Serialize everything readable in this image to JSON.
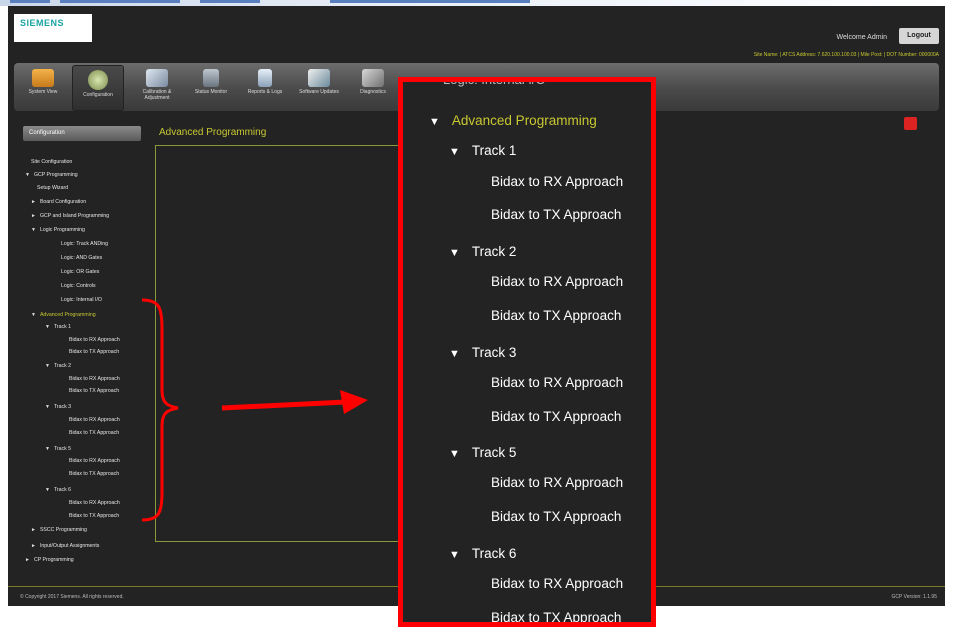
{
  "header": {
    "logo": "SIEMENS",
    "welcome": "Welcome Admin",
    "logout": "Logout",
    "site_info": "Site Name: | ATCS Address: 7.620.100.100.03 | Mile Post: | DOT Number: 000000A"
  },
  "toolbar": {
    "items": [
      {
        "label": "System View",
        "icon": "house-icon"
      },
      {
        "label": "Configuration",
        "icon": "gears-icon"
      },
      {
        "label": "Calibration & Adjustment",
        "icon": "wrench-icon"
      },
      {
        "label": "Status Monitor",
        "icon": "monitor-icon"
      },
      {
        "label": "Reports & Logs",
        "icon": "document-icon"
      },
      {
        "label": "Software Updates",
        "icon": "update-icon"
      },
      {
        "label": "Diagnostics",
        "icon": "diagnostics-icon"
      }
    ]
  },
  "sidebar": {
    "header": "Configuration",
    "items": [
      {
        "label": "Site Configuration"
      },
      {
        "label": "GCP Programming"
      },
      {
        "label": "Setup Wizard"
      },
      {
        "label": "Board Configuration"
      },
      {
        "label": "GCP and Island Programming"
      },
      {
        "label": "Logic Programming"
      },
      {
        "label": "Logic: Track ANDing"
      },
      {
        "label": "Logic: AND Gates"
      },
      {
        "label": "Logic: OR Gates"
      },
      {
        "label": "Logic: Controls"
      },
      {
        "label": "Logic: Internal I/O"
      },
      {
        "label": "Advanced Programming"
      },
      {
        "label": "Track 1"
      },
      {
        "label": "Bidax to RX Approach"
      },
      {
        "label": "Bidax to TX Approach"
      },
      {
        "label": "Track 2"
      },
      {
        "label": "Bidax to RX Approach"
      },
      {
        "label": "Bidax to TX Approach"
      },
      {
        "label": "Track 3"
      },
      {
        "label": "Bidax to RX Approach"
      },
      {
        "label": "Bidax to TX Approach"
      },
      {
        "label": "Track 5"
      },
      {
        "label": "Bidax to RX Approach"
      },
      {
        "label": "Bidax to TX Approach"
      },
      {
        "label": "Track 6"
      },
      {
        "label": "Bidax to RX Approach"
      },
      {
        "label": "Bidax to TX Approach"
      },
      {
        "label": "SSCC Programming"
      },
      {
        "label": "Input/Output Assignments"
      },
      {
        "label": "CP Programming"
      }
    ]
  },
  "main": {
    "title": "Advanced Programming"
  },
  "zoom": {
    "cut_label": "Logic: Internal I/O",
    "items": [
      {
        "label": "Advanced Programming"
      },
      {
        "label": "Track 1"
      },
      {
        "label": "Bidax to RX Approach"
      },
      {
        "label": "Bidax to TX Approach"
      },
      {
        "label": "Track 2"
      },
      {
        "label": "Bidax to RX Approach"
      },
      {
        "label": "Bidax to TX Approach"
      },
      {
        "label": "Track 3"
      },
      {
        "label": "Bidax to RX Approach"
      },
      {
        "label": "Bidax to TX Approach"
      },
      {
        "label": "Track 5"
      },
      {
        "label": "Bidax to RX Approach"
      },
      {
        "label": "Bidax to TX Approach"
      },
      {
        "label": "Track 6"
      },
      {
        "label": "Bidax to RX Approach"
      },
      {
        "label": "Bidax to TX Approach"
      }
    ]
  },
  "footer": {
    "copyright": "© Copyright 2017 Siemens. All rights reserved.",
    "version": "GCP Version: 1.1.95"
  },
  "colors": {
    "background": "#232323",
    "accent_yellow": "#c8c832",
    "annotation_red": "#ff0000"
  }
}
